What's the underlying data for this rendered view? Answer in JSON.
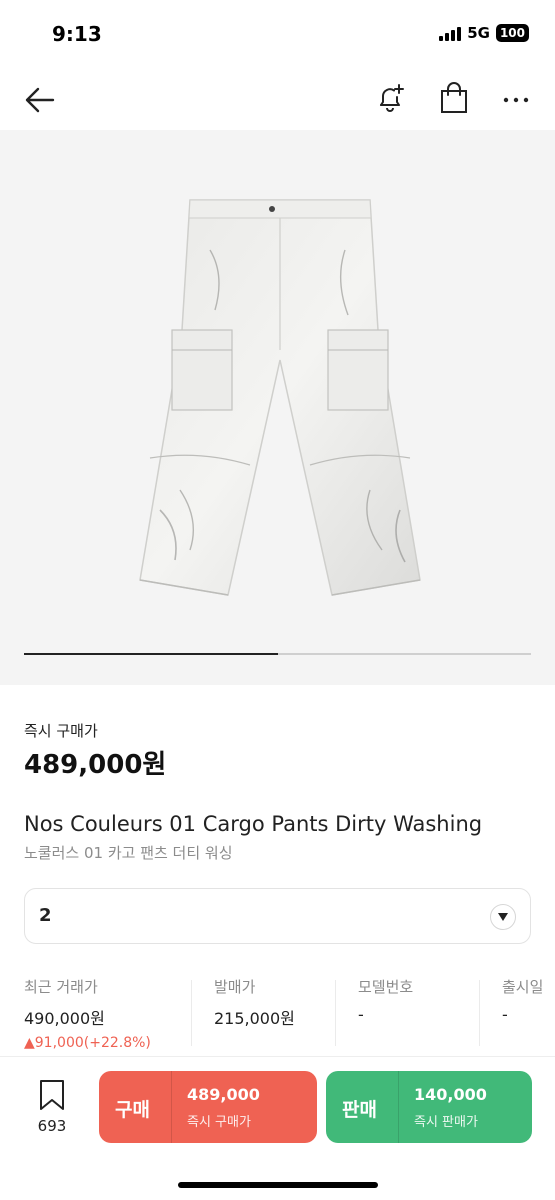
{
  "status_bar": {
    "time": "9:13",
    "network": "5G",
    "battery": "100"
  },
  "product_image": {
    "progress": 0.5
  },
  "price": {
    "label": "즉시 구매가",
    "value": "489,000원"
  },
  "title": {
    "en": "Nos Couleurs 01 Cargo Pants Dirty Washing",
    "ko": "노쿨러스 01 카고 팬츠 더티 워싱"
  },
  "size_select": {
    "value": "2"
  },
  "stats": {
    "recent": {
      "label": "최근 거래가",
      "value": "490,000원",
      "change": "▲91,000(+22.8%)"
    },
    "release_price": {
      "label": "발매가",
      "value": "215,000원"
    },
    "model": {
      "label": "모델번호",
      "value": "-"
    },
    "release_date": {
      "label": "출시일",
      "value": "-"
    }
  },
  "bottom": {
    "wish_count": "693",
    "buy": {
      "label": "구매",
      "price": "489,000",
      "sub": "즉시 구매가"
    },
    "sell": {
      "label": "판매",
      "price": "140,000",
      "sub": "즉시 판매가"
    }
  },
  "colors": {
    "buy": "#ef6253",
    "sell": "#41b979",
    "change": "#ef6253"
  }
}
